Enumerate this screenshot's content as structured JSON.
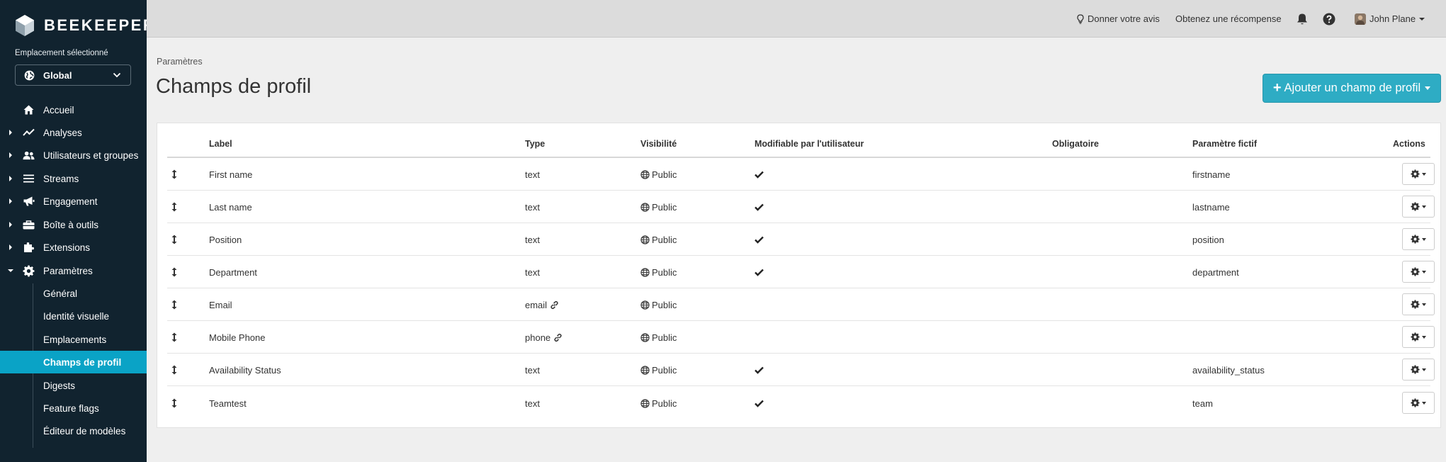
{
  "app": {
    "logo_text": "BEEKEEPER"
  },
  "sidebar": {
    "location_label": "Emplacement sélectionné",
    "location_value": "Global",
    "items": [
      {
        "label": "Accueil",
        "icon": "home-icon",
        "expandable": false
      },
      {
        "label": "Analyses",
        "icon": "chart-line-icon",
        "expandable": true
      },
      {
        "label": "Utilisateurs et groupes",
        "icon": "users-icon",
        "expandable": true
      },
      {
        "label": "Streams",
        "icon": "list-icon",
        "expandable": true
      },
      {
        "label": "Engagement",
        "icon": "megaphone-icon",
        "expandable": true
      },
      {
        "label": "Boîte à outils",
        "icon": "toolbox-icon",
        "expandable": true
      },
      {
        "label": "Extensions",
        "icon": "puzzle-icon",
        "expandable": true
      },
      {
        "label": "Paramètres",
        "icon": "gear-icon",
        "expandable": true,
        "expanded": true
      }
    ],
    "subitems": [
      {
        "label": "Général"
      },
      {
        "label": "Identité visuelle"
      },
      {
        "label": "Emplacements"
      },
      {
        "label": "Champs de profil",
        "active": true
      },
      {
        "label": "Digests"
      },
      {
        "label": "Feature flags"
      },
      {
        "label": "Éditeur de modèles"
      }
    ]
  },
  "topbar": {
    "feedback": "Donner votre avis",
    "reward": "Obtenez une récompense",
    "user": "John Plane"
  },
  "page": {
    "breadcrumb": "Paramètres",
    "title": "Champs de profil",
    "add_button": "Ajouter un champ de profil"
  },
  "table": {
    "headers": {
      "label": "Label",
      "type": "Type",
      "visibility": "Visibilité",
      "editable": "Modifiable par l'utilisateur",
      "required": "Obligatoire",
      "placeholder": "Paramètre fictif",
      "actions": "Actions"
    },
    "rows": [
      {
        "label": "First name",
        "type": "text",
        "link": false,
        "visibility": "Public",
        "editable": true,
        "placeholder": "firstname"
      },
      {
        "label": "Last name",
        "type": "text",
        "link": false,
        "visibility": "Public",
        "editable": true,
        "placeholder": "lastname"
      },
      {
        "label": "Position",
        "type": "text",
        "link": false,
        "visibility": "Public",
        "editable": true,
        "placeholder": "position"
      },
      {
        "label": "Department",
        "type": "text",
        "link": false,
        "visibility": "Public",
        "editable": true,
        "placeholder": "department"
      },
      {
        "label": "Email",
        "type": "email",
        "link": true,
        "visibility": "Public",
        "editable": false,
        "placeholder": ""
      },
      {
        "label": "Mobile Phone",
        "type": "phone",
        "link": true,
        "visibility": "Public",
        "editable": false,
        "placeholder": ""
      },
      {
        "label": "Availability Status",
        "type": "text",
        "link": false,
        "visibility": "Public",
        "editable": true,
        "placeholder": "availability_status"
      },
      {
        "label": "Teamtest",
        "type": "text",
        "link": false,
        "visibility": "Public",
        "editable": true,
        "placeholder": "team"
      }
    ]
  },
  "colors": {
    "sidebar_bg": "#11232f",
    "accent": "#0aa3c6",
    "button": "#2eacc4"
  }
}
